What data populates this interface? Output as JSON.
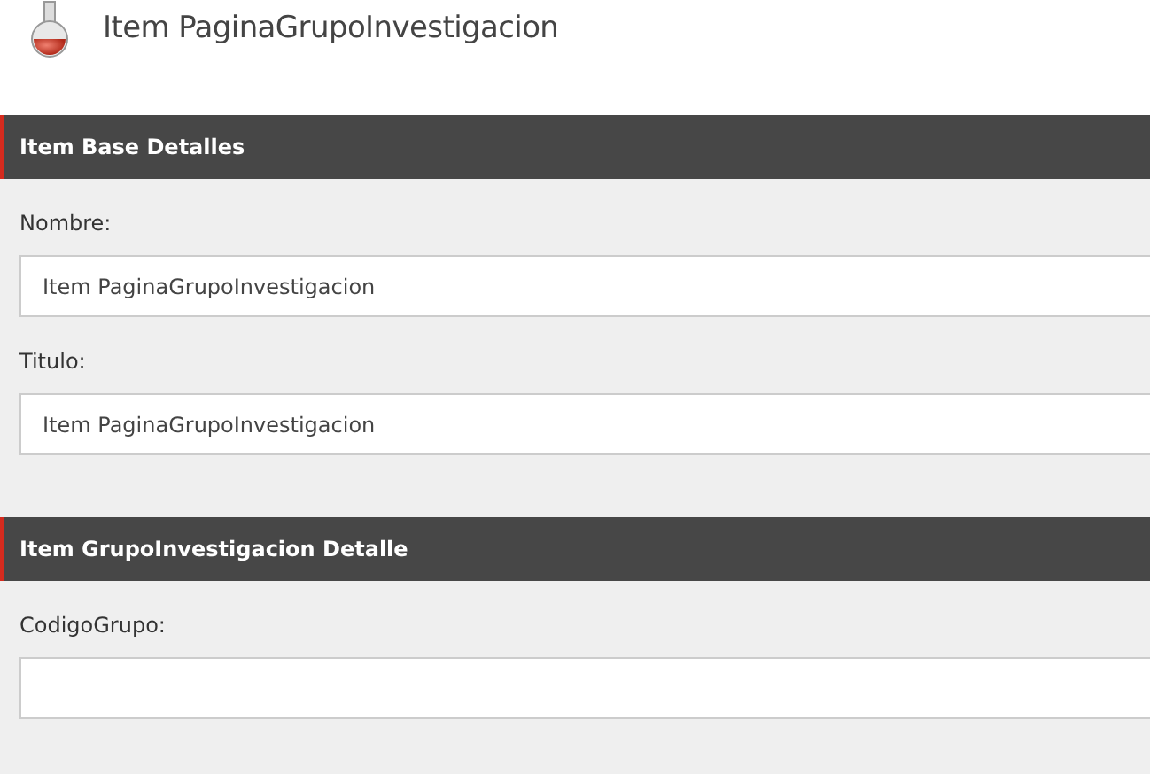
{
  "header": {
    "title": "Item PaginaGrupoInvestigacion"
  },
  "sections": [
    {
      "title": "Item Base Detalles",
      "fields": [
        {
          "label": "Nombre:",
          "value": "Item PaginaGrupoInvestigacion"
        },
        {
          "label": "Titulo:",
          "value": "Item PaginaGrupoInvestigacion"
        }
      ]
    },
    {
      "title": "Item GrupoInvestigacion Detalle",
      "fields": [
        {
          "label": "CodigoGrupo:"
        }
      ]
    }
  ]
}
